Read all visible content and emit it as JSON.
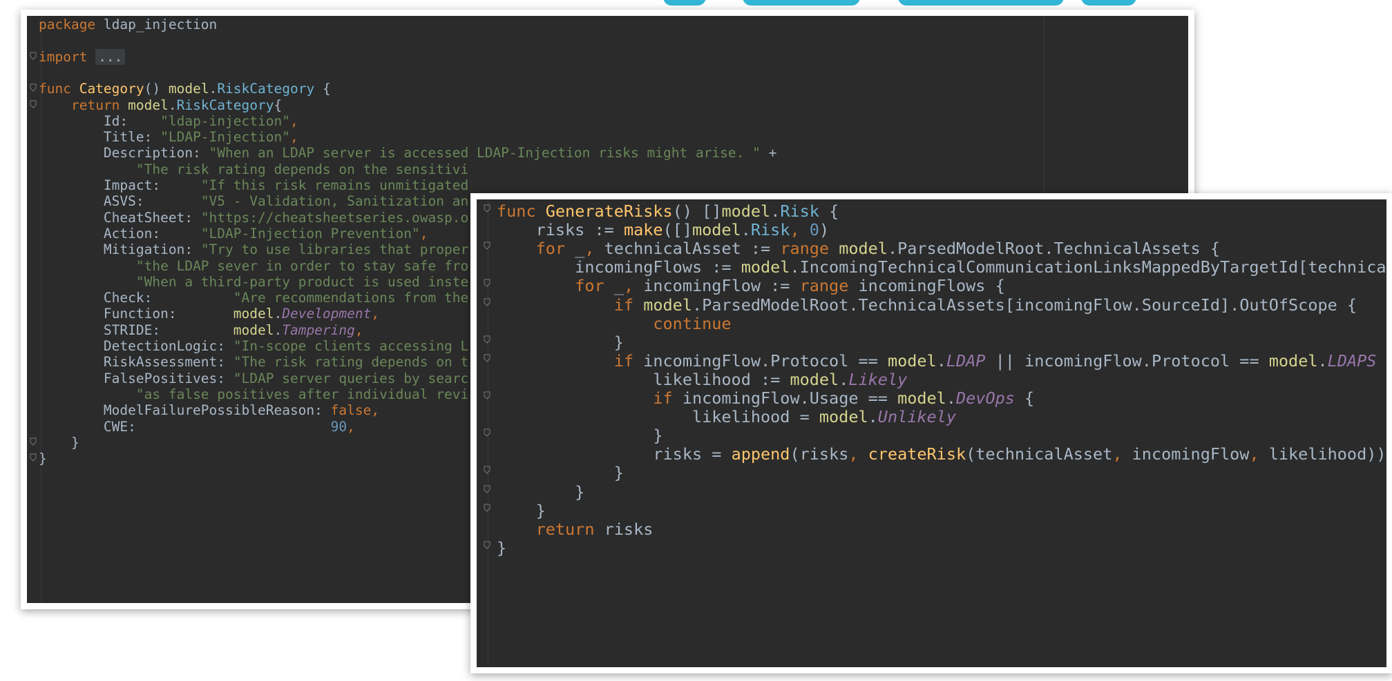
{
  "back_editor": {
    "lines": [
      [
        [
          "kw",
          "package "
        ],
        [
          "",
          "ldap_injection"
        ]
      ],
      [],
      [
        [
          "kw",
          "import "
        ],
        [
          "fold-box",
          "..."
        ]
      ],
      [],
      [
        [
          "kw",
          "func "
        ],
        [
          "fn",
          "Category"
        ],
        [
          "",
          "() "
        ],
        [
          "pkg",
          "model"
        ],
        [
          "",
          "."
        ],
        [
          "ty",
          "RiskCategory"
        ],
        [
          "",
          " {"
        ]
      ],
      [
        [
          "",
          "    "
        ],
        [
          "kw",
          "return "
        ],
        [
          "pkg",
          "model"
        ],
        [
          "",
          "."
        ],
        [
          "ty",
          "RiskCategory"
        ],
        [
          "",
          "{"
        ]
      ],
      [
        [
          "",
          "        Id:    "
        ],
        [
          "str",
          "\"ldap-injection\""
        ],
        [
          "kw",
          ","
        ]
      ],
      [
        [
          "",
          "        Title: "
        ],
        [
          "str",
          "\"LDAP-Injection\""
        ],
        [
          "kw",
          ","
        ]
      ],
      [
        [
          "",
          "        Description: "
        ],
        [
          "str",
          "\"When an LDAP server is accessed LDAP-Injection risks might arise. \""
        ],
        [
          "",
          " +"
        ]
      ],
      [
        [
          "",
          "            "
        ],
        [
          "str",
          "\"The risk rating depends on the sensitivi"
        ]
      ],
      [
        [
          "",
          "        Impact:     "
        ],
        [
          "str",
          "\"If this risk remains unmitigated"
        ]
      ],
      [
        [
          "",
          "        ASVS:       "
        ],
        [
          "str",
          "\"V5 - Validation, Sanitization an"
        ]
      ],
      [
        [
          "",
          "        CheatSheet: "
        ],
        [
          "str",
          "\"https://cheatsheetseries.owasp.o"
        ]
      ],
      [
        [
          "",
          "        Action:     "
        ],
        [
          "str",
          "\"LDAP-Injection Prevention\""
        ],
        [
          "kw",
          ","
        ]
      ],
      [
        [
          "",
          "        Mitigation: "
        ],
        [
          "str",
          "\"Try to use libraries that proper"
        ]
      ],
      [
        [
          "",
          "            "
        ],
        [
          "str",
          "\"the LDAP sever in order to stay safe fro"
        ]
      ],
      [
        [
          "",
          "            "
        ],
        [
          "str",
          "\"When a third-party product is used inste"
        ]
      ],
      [
        [
          "",
          "        Check:          "
        ],
        [
          "str",
          "\"Are recommendations from the"
        ]
      ],
      [
        [
          "",
          "        Function:       "
        ],
        [
          "pkg",
          "model"
        ],
        [
          "",
          "."
        ],
        [
          "cst",
          "Development"
        ],
        [
          "kw",
          ","
        ]
      ],
      [
        [
          "",
          "        STRIDE:         "
        ],
        [
          "pkg",
          "model"
        ],
        [
          "",
          "."
        ],
        [
          "cst",
          "Tampering"
        ],
        [
          "kw",
          ","
        ]
      ],
      [
        [
          "",
          "        DetectionLogic: "
        ],
        [
          "str",
          "\"In-scope clients accessing L"
        ]
      ],
      [
        [
          "",
          "        RiskAssessment: "
        ],
        [
          "str",
          "\"The risk rating depends on t"
        ]
      ],
      [
        [
          "",
          "        FalsePositives: "
        ],
        [
          "str",
          "\"LDAP server queries by searc"
        ]
      ],
      [
        [
          "",
          "            "
        ],
        [
          "str",
          "\"as false positives after individual revi"
        ]
      ],
      [
        [
          "",
          "        ModelFailurePossibleReason: "
        ],
        [
          "kw",
          "false,"
        ]
      ],
      [
        [
          "",
          "        CWE:                        "
        ],
        [
          "num",
          "90"
        ],
        [
          "kw",
          ","
        ]
      ],
      [
        [
          "",
          "    }"
        ]
      ],
      [
        [
          "",
          "}"
        ]
      ]
    ]
  },
  "front_editor": {
    "lines": [
      [
        [
          "kw",
          "func "
        ],
        [
          "fn",
          "GenerateRisks"
        ],
        [
          "",
          "() []"
        ],
        [
          "pkg",
          "model"
        ],
        [
          "",
          "."
        ],
        [
          "ty",
          "Risk"
        ],
        [
          "",
          " {"
        ]
      ],
      [
        [
          "",
          "    risks := "
        ],
        [
          "fn",
          "make"
        ],
        [
          "",
          "([]"
        ],
        [
          "pkg",
          "model"
        ],
        [
          "",
          "."
        ],
        [
          "ty",
          "Risk"
        ],
        [
          "kw",
          ", "
        ],
        [
          "num",
          "0"
        ],
        [
          "",
          ")"
        ]
      ],
      [
        [
          "",
          "    "
        ],
        [
          "kw",
          "for "
        ],
        [
          "",
          "_"
        ],
        [
          "kw",
          ", "
        ],
        [
          "",
          "technicalAsset := "
        ],
        [
          "kw",
          "range "
        ],
        [
          "pkg",
          "model"
        ],
        [
          "",
          ".ParsedModelRoot.TechnicalAssets {"
        ]
      ],
      [
        [
          "",
          "        incomingFlows := "
        ],
        [
          "pkg",
          "model"
        ],
        [
          "",
          ".IncomingTechnicalCommunicationLinksMappedByTargetId[technical"
        ]
      ],
      [
        [
          "",
          "        "
        ],
        [
          "kw",
          "for "
        ],
        [
          "",
          "_"
        ],
        [
          "kw",
          ", "
        ],
        [
          "",
          "incomingFlow := "
        ],
        [
          "kw",
          "range "
        ],
        [
          "",
          "incomingFlows {"
        ]
      ],
      [
        [
          "",
          "            "
        ],
        [
          "kw",
          "if "
        ],
        [
          "pkg",
          "model"
        ],
        [
          "",
          ".ParsedModelRoot.TechnicalAssets[incomingFlow.SourceId].OutOfScope {"
        ]
      ],
      [
        [
          "",
          "                "
        ],
        [
          "kw",
          "continue"
        ]
      ],
      [
        [
          "",
          "            }"
        ]
      ],
      [
        [
          "",
          "            "
        ],
        [
          "kw",
          "if "
        ],
        [
          "",
          "incomingFlow.Protocol == "
        ],
        [
          "pkg",
          "model"
        ],
        [
          "",
          "."
        ],
        [
          "cst",
          "LDAP"
        ],
        [
          "",
          " || incomingFlow.Protocol == "
        ],
        [
          "pkg",
          "model"
        ],
        [
          "",
          "."
        ],
        [
          "cst",
          "LDAPS"
        ],
        [
          "",
          " {"
        ]
      ],
      [
        [
          "",
          "                likelihood := "
        ],
        [
          "pkg",
          "model"
        ],
        [
          "",
          "."
        ],
        [
          "cst",
          "Likely"
        ]
      ],
      [
        [
          "",
          "                "
        ],
        [
          "kw",
          "if "
        ],
        [
          "",
          "incomingFlow.Usage == "
        ],
        [
          "pkg",
          "model"
        ],
        [
          "",
          "."
        ],
        [
          "cst",
          "DevOps"
        ],
        [
          "",
          " {"
        ]
      ],
      [
        [
          "",
          "                    likelihood = "
        ],
        [
          "pkg",
          "model"
        ],
        [
          "",
          "."
        ],
        [
          "cst",
          "Unlikely"
        ]
      ],
      [
        [
          "",
          "                }"
        ]
      ],
      [
        [
          "",
          "                risks = "
        ],
        [
          "fn",
          "append"
        ],
        [
          "",
          "(risks"
        ],
        [
          "kw",
          ", "
        ],
        [
          "fn",
          "createRisk"
        ],
        [
          "",
          "(technicalAsset"
        ],
        [
          "kw",
          ", "
        ],
        [
          "",
          "incomingFlow"
        ],
        [
          "kw",
          ", "
        ],
        [
          "",
          "likelihood))"
        ]
      ],
      [
        [
          "",
          "            }"
        ]
      ],
      [
        [
          "",
          "        }"
        ]
      ],
      [
        [
          "",
          "    }"
        ]
      ],
      [
        [
          "",
          "    "
        ],
        [
          "kw",
          "return "
        ],
        [
          "",
          "risks"
        ]
      ],
      [
        [
          "",
          "}"
        ]
      ]
    ]
  }
}
